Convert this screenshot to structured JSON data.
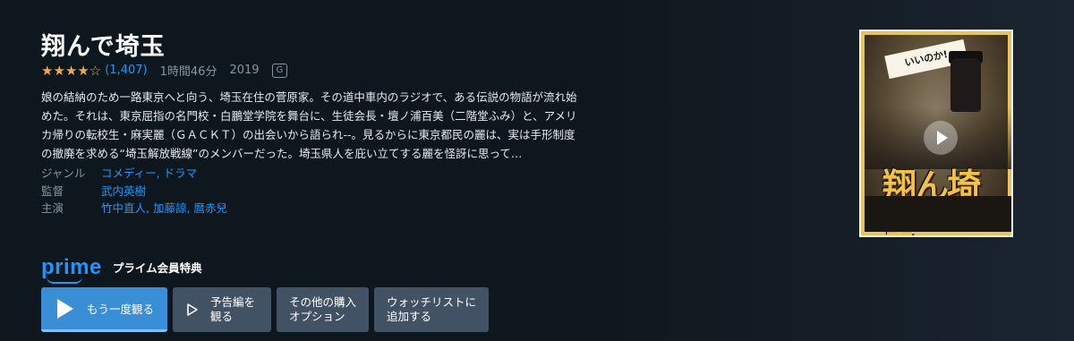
{
  "movie": {
    "title": "翔んで埼玉",
    "stars_filled": "★★★★",
    "stars_empty": "☆",
    "rating_value": 4,
    "rating_count": "(1,407)",
    "runtime": "1時間46分",
    "year": "2019",
    "age_rating": "G",
    "synopsis": "娘の結納のため一路東京へと向う、埼玉在住の菅原家。その道中車内のラジオで、ある伝説の物語が流れ始めた。それは、東京屈指の名門校・白鵬堂学院を舞台に、生徒会長・壇ノ浦百美（二階堂ふみ）と、アメリカ帰りの転校生・麻実麗（ＧＡＣＫＴ）の出会いから語られ--。見るからに東京都民の麗は、実は手形制度の撤廃を求める“埼玉解放戦線”のメンバーだった。埼玉県人を庇い立てする麗を怪訝に思って…"
  },
  "details": {
    "genre_label": "ジャンル",
    "genre_value": "コメディー, ドラマ",
    "director_label": "監督",
    "director_value": "武内英樹",
    "cast_label": "主演",
    "cast_value": "竹中直人, 加藤諒, 麿赤兒"
  },
  "prime": {
    "logo": "prime",
    "label": "プライム会員特典"
  },
  "buttons": {
    "watch_again": "もう一度観る",
    "trailer_line1": "予告編を",
    "trailer_line2": "観る",
    "more_purchase_line1": "その他の購入",
    "more_purchase_line2": "オプション",
    "watchlist_line1": "ウォッチリストに",
    "watchlist_line2": "追加する"
  },
  "poster": {
    "title_art": "翔ん埼玉",
    "tagline_art": "いいのか!"
  },
  "colors": {
    "background": "#0f171e",
    "accent_blue": "#1a98ff",
    "star": "#f3a847",
    "primary_button": "#3a8ed6",
    "secondary_button": "#425265"
  }
}
